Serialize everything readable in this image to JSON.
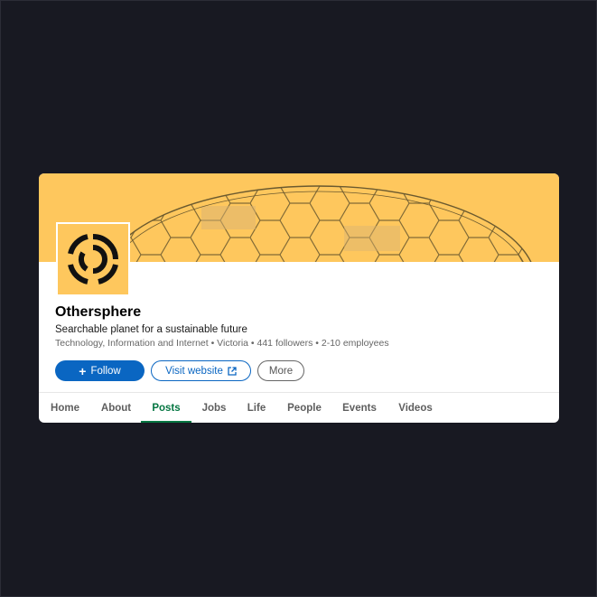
{
  "company": {
    "name": "Othersphere",
    "tagline": "Searchable planet for a sustainable future",
    "meta": "Technology, Information and Internet • Victoria • 441 followers • 2-10 employees"
  },
  "actions": {
    "follow_label": "Follow",
    "visit_label": "Visit website",
    "more_label": "More"
  },
  "tabs": [
    {
      "label": "Home"
    },
    {
      "label": "About"
    },
    {
      "label": "Posts",
      "active": true
    },
    {
      "label": "Jobs"
    },
    {
      "label": "Life"
    },
    {
      "label": "People"
    },
    {
      "label": "Events"
    },
    {
      "label": "Videos"
    }
  ],
  "colors": {
    "banner": "#fec75d",
    "primary": "#0a66c2",
    "active_tab": "#057642",
    "background": "#181922"
  },
  "icons": {
    "follow": "plus-icon",
    "visit": "external-link-icon",
    "logo": "othersphere-logo-icon"
  }
}
